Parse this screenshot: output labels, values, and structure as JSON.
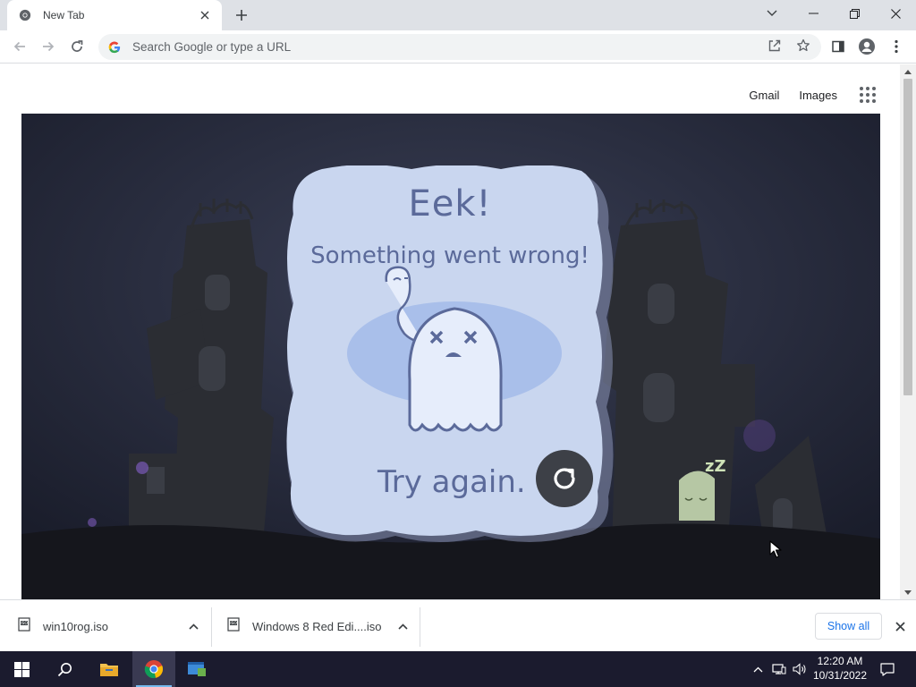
{
  "browser": {
    "tab": {
      "title": "New Tab"
    },
    "omnibox": {
      "placeholder": "Search Google or type a URL",
      "value": ""
    }
  },
  "ntp": {
    "links": {
      "gmail": "Gmail",
      "images": "Images"
    },
    "doodle": {
      "heading": "Eek!",
      "message": "Something went wrong!",
      "retry_label": "Try again.",
      "sleep_text": "zZ"
    }
  },
  "downloads": {
    "items": [
      {
        "filename": "win10rog.iso"
      },
      {
        "filename": "Windows 8 Red Edi....iso"
      }
    ],
    "show_all": "Show all"
  },
  "taskbar": {
    "clock": {
      "time": "12:20 AM",
      "date": "10/31/2022"
    }
  },
  "colors": {
    "tabstrip": "#dee1e6",
    "doodle_bg": "#202334",
    "card": "#c9d6ef",
    "ghost_text": "#5b6a9a",
    "link_blue": "#1a73e8",
    "taskbar": "#1b1b2e"
  }
}
